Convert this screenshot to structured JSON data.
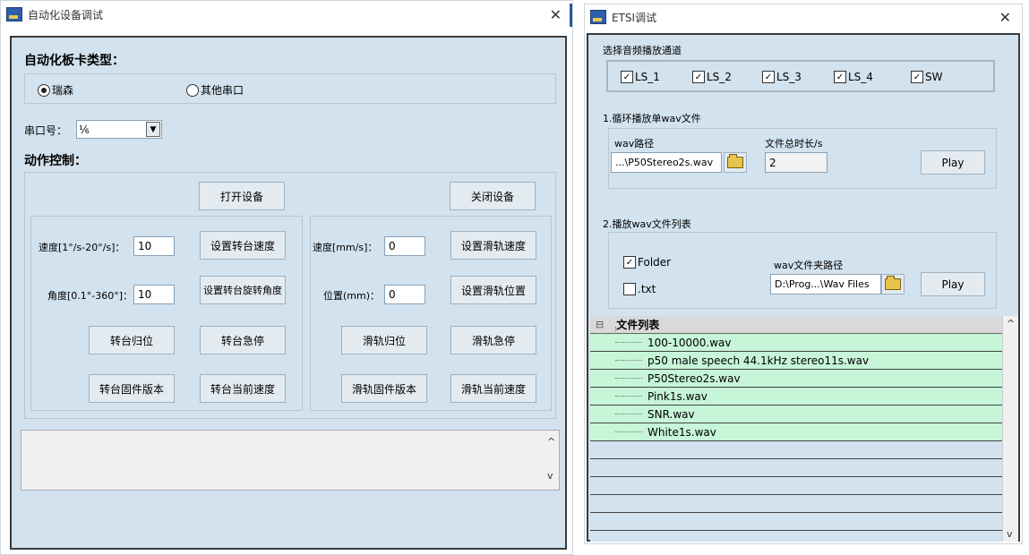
{
  "left_window": {
    "title": "自动化设备调试",
    "close": "✕",
    "board_type_label": "自动化板卡类型：",
    "radio_ruisen": "瑞森",
    "radio_other": "其他串口",
    "serial_label": "串口号：",
    "serial_value": "⅙",
    "action_label": "动作控制：",
    "open_device": "打开设备",
    "close_device": "关闭设备",
    "speed_deg_label": "速度[1°/s-20°/s]：",
    "speed_deg_value": "10",
    "set_turntable_speed": "设置转台速度",
    "speed_mm_label": "速度[mm/s]：",
    "speed_mm_value": "0",
    "set_slide_speed": "设置滑轨速度",
    "angle_label": "角度[0.1°-360°]：",
    "angle_value": "10",
    "set_turntable_angle": "设置转台旋转角度",
    "position_label": "位置(mm)：",
    "position_value": "0",
    "set_slide_position": "设置滑轨位置",
    "turntable_home": "转台归位",
    "turntable_stop": "转台急停",
    "slide_home": "滑轨归位",
    "slide_stop": "滑轨急停",
    "turntable_firmware": "转台固件版本",
    "turntable_current_speed": "转台当前速度",
    "slide_firmware": "滑轨固件版本",
    "slide_current_speed": "滑轨当前速度",
    "scroll_up": "^",
    "scroll_down": "v"
  },
  "right_window": {
    "title": "ETSI调试",
    "close": "✕",
    "channel_label": "选择音频播放通道",
    "channels": [
      "LS_1",
      "LS_2",
      "LS_3",
      "LS_4",
      "SW"
    ],
    "check_mark": "✓",
    "section1_title": "1.循环播放单wav文件",
    "wav_path_label": "wav路径",
    "wav_path_value": "...\\P50Stereo2s.wav",
    "duration_label": "文件总时长/s",
    "duration_value": "2",
    "play1": "Play",
    "section2_title": "2.播放wav文件列表",
    "folder_label": "Folder",
    "txt_label": ".txt",
    "folder_path_label": "wav文件夹路径",
    "folder_path_value": "D:\\Prog...\\Wav Files",
    "play2": "Play",
    "file_list_header": "文件列表",
    "tree_toggle": "⊟",
    "files": [
      "100-10000.wav",
      "p50 male speech 44.1kHz stereo11s.wav",
      "P50Stereo2s.wav",
      "Pink1s.wav",
      "SNR.wav",
      "White1s.wav"
    ],
    "scroll_up": "^",
    "scroll_down": "v"
  }
}
